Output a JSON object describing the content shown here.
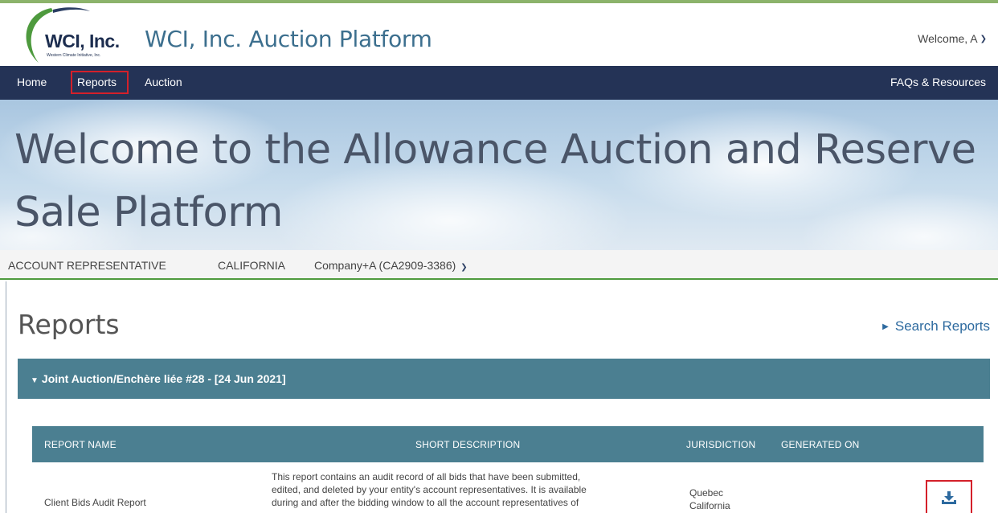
{
  "header": {
    "logo_text": "WCI, Inc.",
    "logo_subtext": "Western Climate Initiative, Inc.",
    "app_title": "WCI, Inc. Auction Platform",
    "welcome_text": "Welcome, A"
  },
  "nav": {
    "items": [
      {
        "label": "Home"
      },
      {
        "label": "Reports",
        "highlighted": true
      },
      {
        "label": "Auction"
      }
    ],
    "right_link": "FAQs & Resources"
  },
  "hero": {
    "title": "Welcome to the Allowance Auction and Reserve Sale Platform"
  },
  "context": {
    "role": "ACCOUNT REPRESENTATIVE",
    "jurisdiction": "CALIFORNIA",
    "company": "Company+A (CA2909-3386)"
  },
  "reports": {
    "title": "Reports",
    "search_link": "Search Reports",
    "auction_group": "Joint Auction/Enchère liée #28 - [24 Jun 2021]",
    "columns": [
      "REPORT NAME",
      "SHORT DESCRIPTION",
      "JURISDICTION",
      "GENERATED ON"
    ],
    "rows": [
      {
        "name": "Client Bids Audit Report",
        "description_lines": [
          "This report contains an audit record of all bids that have been submitted,",
          "edited, and deleted by your entity's account representatives. It is available",
          "during and after the bidding window to all the account representatives of"
        ],
        "jurisdictions": [
          "Quebec",
          "California"
        ],
        "generated_on": ""
      }
    ]
  },
  "colors": {
    "navbar": "#243356",
    "section_bar": "#4b7f91",
    "highlight_box": "#d4202a",
    "accent_green": "#4e9a3e",
    "link": "#2d6a9f"
  }
}
